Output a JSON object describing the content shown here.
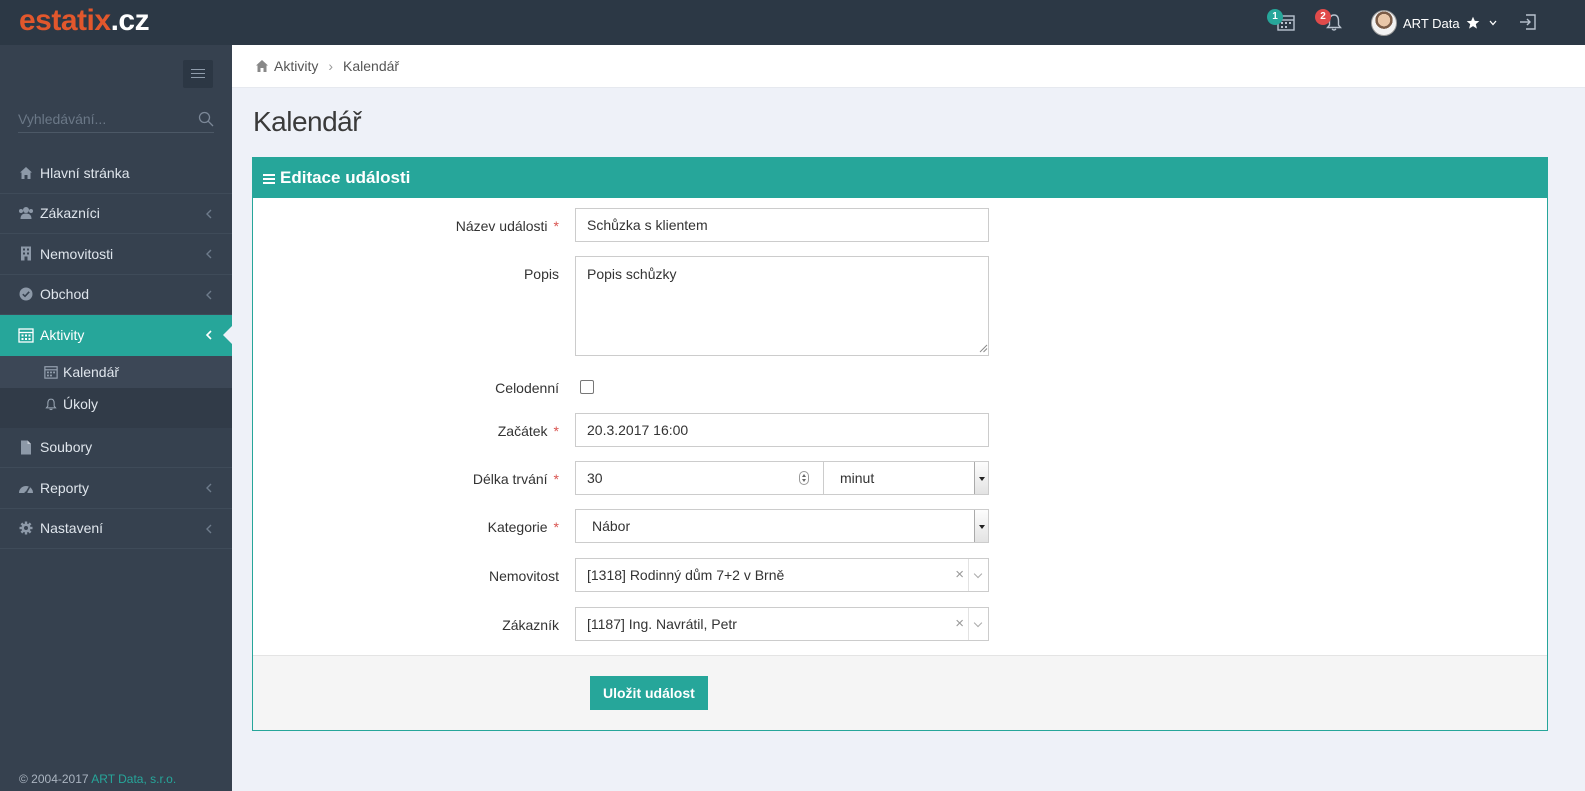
{
  "brand": {
    "part1": "estatix",
    "part2": ".cz"
  },
  "topbar": {
    "calendar_badge": "1",
    "notification_badge": "2",
    "user_name": "ART Data"
  },
  "sidebar": {
    "search_placeholder": "Vyhledávání...",
    "items": [
      {
        "label": "Hlavní stránka",
        "icon": "home-icon"
      },
      {
        "label": "Zákazníci",
        "icon": "users-icon"
      },
      {
        "label": "Nemovitosti",
        "icon": "building-icon"
      },
      {
        "label": "Obchod",
        "icon": "check-circle-icon"
      },
      {
        "label": "Aktivity",
        "icon": "calendar-icon"
      },
      {
        "label": "Soubory",
        "icon": "file-icon"
      },
      {
        "label": "Reporty",
        "icon": "dashboard-icon"
      },
      {
        "label": "Nastavení",
        "icon": "gear-icon"
      }
    ],
    "subitems": [
      {
        "label": "Kalendář",
        "icon": "calendar-icon"
      },
      {
        "label": "Úkoly",
        "icon": "bell-icon"
      }
    ],
    "footer_copyright": "© 2004-2017",
    "footer_company": "ART Data, s.r.o."
  },
  "breadcrumb": {
    "parent": "Aktivity",
    "current": "Kalendář"
  },
  "page": {
    "title": "Kalendář"
  },
  "panel": {
    "title": "Editace události",
    "fields": {
      "name_label": "Název události",
      "name_value": "Schůzka s klientem",
      "desc_label": "Popis",
      "desc_value": "Popis schůzky",
      "allday_label": "Celodenní",
      "start_label": "Začátek",
      "start_value": "20.3.2017 16:00",
      "duration_label": "Délka trvání",
      "duration_value": "30",
      "duration_unit": "minut",
      "category_label": "Kategorie",
      "category_value": "Nábor",
      "property_label": "Nemovitost",
      "property_value": "[1318] Rodinný dům 7+2 v Brně",
      "customer_label": "Zákazník",
      "customer_value": "[1187] Ing. Navrátil, Petr"
    },
    "required_mark": "*",
    "clear_mark": "×",
    "save_label": "Uložit událost"
  },
  "colors": {
    "accent": "#26a69a",
    "sidebar": "#36414f",
    "topbar": "#2c3845",
    "brand": "#e2572c"
  }
}
